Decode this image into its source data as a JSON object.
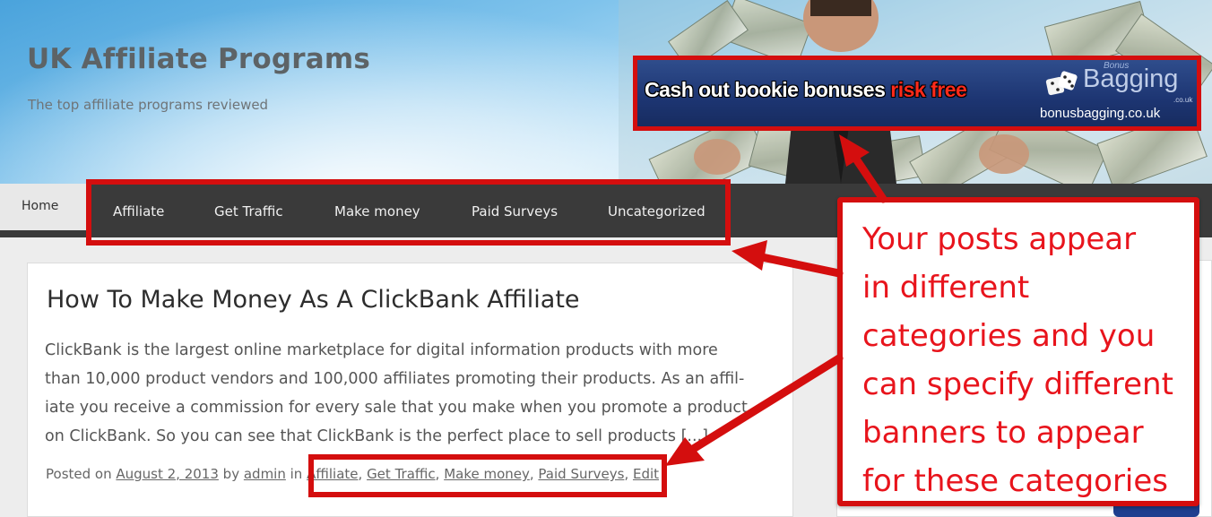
{
  "header": {
    "site_title": "UK Affiliate Programs",
    "tagline": "The top affiliate programs reviewed"
  },
  "ad_banner": {
    "text_part1": "Cash out bookie bonuses ",
    "text_part2": "risk free",
    "logo_small": "Bonus",
    "logo": "Bagging",
    "logo_suffix": ".co.uk",
    "url": "bonusbagging.co.uk"
  },
  "nav": {
    "home": "Home",
    "items": [
      "Affiliate",
      "Get Traffic",
      "Make money",
      "Paid Surveys",
      "Uncategorized"
    ]
  },
  "post": {
    "title": "How To Make Money As A ClickBank Affiliate",
    "excerpt_lines": [
      "ClickBank is the largest online marketplace for digital information products with more",
      "than 10,000 product vendors and 100,000 affiliates promoting their products. As an affil-",
      "iate you receive a commission for every sale that you make when you promote a product",
      "on ClickBank. So you can see that ClickBank is the perfect place to sell products [...]"
    ],
    "meta": {
      "posted_on": "Posted on",
      "date": "August 2, 2013",
      "by": "by",
      "author": "admin",
      "in": "in",
      "categories": [
        "Affiliate",
        "Get Traffic",
        "Make money",
        "Paid Surveys"
      ],
      "sep": ", ",
      "edit": "Edit"
    }
  },
  "callout": {
    "text": "Your posts appear\nin different\ncategories and you\ncan specify different\nbanners to appear\nfor these categories"
  },
  "colors": {
    "annotation_red": "#d40e0e",
    "nav_bg": "#3a3a3a",
    "ad_bg": "#1d3572"
  }
}
